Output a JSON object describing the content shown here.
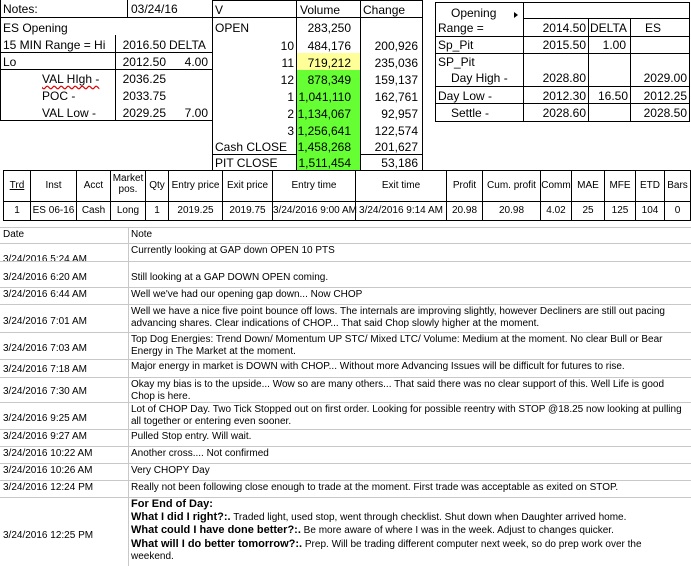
{
  "sheet": {
    "notes_label": "Notes:",
    "date": "03/24/16",
    "left_rows": [
      {
        "label": "ES Opening",
        "value": "",
        "extra": ""
      },
      {
        "label": "15 MIN Range = Hi",
        "value": "2016.50",
        "extra": "DELTA"
      },
      {
        "label": "Lo",
        "value": "2012.50",
        "extra": "4.00"
      },
      {
        "label": "VAL HIgh   -",
        "value": "2036.25",
        "extra": ""
      },
      {
        "label": "POC   -",
        "value": "2033.75",
        "extra": ""
      },
      {
        "label": "VAL Low   -",
        "value": "2029.25",
        "extra": "7.00"
      }
    ],
    "volume_table": {
      "headers": [
        "V",
        "Volume",
        "Change"
      ],
      "open_label": "OPEN",
      "open_volume": "283,250",
      "rows": [
        {
          "period": "10",
          "volume": "484,176",
          "change": "200,926",
          "hl": ""
        },
        {
          "period": "11",
          "volume": "719,212",
          "change": "235,036",
          "hl": "#ffff99"
        },
        {
          "period": "12",
          "volume": "878,349",
          "change": "159,137",
          "hl": "#66ff33"
        },
        {
          "period": "1",
          "volume": "1,041,110",
          "change": "162,761",
          "hl": "#66ff33"
        },
        {
          "period": "2",
          "volume": "1,134,067",
          "change": "92,957",
          "hl": "#66ff33"
        },
        {
          "period": "3",
          "volume": "1,256,641",
          "change": "122,574",
          "hl": "#66ff33"
        }
      ],
      "cash_close_label": "Cash CLOSE",
      "cash_close_volume": "1,458,268",
      "cash_close_change": "201,627",
      "pit_close_label": "PIT CLOSE",
      "pit_close_volume": "1,511,454",
      "pit_close_change": "53,186"
    },
    "right_box": {
      "opening_label": "Opening",
      "range_label": "Range =",
      "range_value": "2014.50",
      "delta_label": "DELTA",
      "es_label": "ES",
      "sp_pit_label": "Sp_Pit",
      "sp_pit_value": "2015.50",
      "sp_pit_delta": "1.00",
      "sp_pit2_label": "SP_Pit",
      "day_high_label": "Day High -",
      "day_high_value": "2028.80",
      "day_high_es": "2029.00",
      "day_low_label": "Day Low -",
      "day_low_value": "2012.30",
      "day_low_delta": "16.50",
      "day_low_es": "2012.25",
      "settle_label": "Settle -",
      "settle_value": "2028.60",
      "settle_es": "2028.50"
    }
  },
  "trades": {
    "headers": [
      "Trd",
      "Inst",
      "Acct",
      "Market pos.",
      "Qty",
      "Entry price",
      "Exit price",
      "Entry time",
      "Exit time",
      "Profit",
      "Cum. profit",
      "Comm",
      "MAE",
      "MFE",
      "ETD",
      "Bars"
    ],
    "rows": [
      [
        "1",
        "ES 06-16",
        "Cash",
        "Long",
        "1",
        "2019.25",
        "2019.75",
        "3/24/2016 9:00 AM",
        "3/24/2016 9:14 AM",
        "20.98",
        "20.98",
        "4.02",
        "25",
        "125",
        "104",
        "0"
      ]
    ]
  },
  "notes": {
    "header_date": "Date",
    "header_note": "Note",
    "rows": [
      {
        "date": "3/24/2016 5:24 AM",
        "note": "Currently looking at GAP down OPEN 10 PTS"
      },
      {
        "date": "3/24/2016 6:20 AM",
        "note": "Still looking at a GAP DOWN OPEN coming."
      },
      {
        "date": "3/24/2016 6:44 AM",
        "note": "Well we've had our opening gap down... Now CHOP"
      },
      {
        "date": "3/24/2016 7:01 AM",
        "note": "Well we have a nice five point bounce off lows.  The internals are improving slightly, however Decliners are still out pacing advancing shares.   Clear indications of CHOP... That said Chop slowly higher at the moment."
      },
      {
        "date": "3/24/2016 7:03 AM",
        "note": "Top Dog Energies: Trend Down/ Momentum UP STC/ Mixed LTC/ Volume: Medium at the moment.  No clear Bull or Bear Energy in The Market at the moment."
      },
      {
        "date": "3/24/2016 7:18 AM",
        "note": "Major energy in market is DOWN with CHOP... Without more Advancing Issues will be difficult for futures to rise."
      },
      {
        "date": "3/24/2016 7:30 AM",
        "note": "Okay my bias is to the upside... Wow so are many others... That said there was no clear support of this.  Well Life is good Chop is here."
      },
      {
        "date": "3/24/2016 9:25 AM",
        "note": "Lot of CHOP Day.  Two Tick Stopped out on first order.  Looking for possible reentry with STOP @18.25 now looking at pulling all together or entering even sooner."
      },
      {
        "date": "3/24/2016 9:27 AM",
        "note": "Pulled Stop entry.  Will wait."
      },
      {
        "date": "3/24/2016 10:22 AM",
        "note": "Another cross.... Not confirmed"
      },
      {
        "date": "3/24/2016 10:26 AM",
        "note": "Very CHOPY Day"
      },
      {
        "date": "3/24/2016 12:24 PM",
        "note": "Really not been following close enough to trade at the moment.   First trade was acceptable as exited on STOP."
      }
    ],
    "last": {
      "date": "3/24/2016 12:25 PM",
      "line1_bold": "For End of Day:",
      "q1_bold": "What I did I right?:.",
      "q1_text": "  Traded light, used stop, went through checklist.  Shut down when Daughter arrived home.",
      "q2_bold": "What could I have done better?:.",
      "q2_text": "  Be more aware of where I was in the week.  Adjust to changes quicker.",
      "q3_bold": "What will I do better tomorrow?:.",
      "q3_text": "  Prep.  Will be trading different computer next week, so do prep work over the weekend."
    }
  }
}
